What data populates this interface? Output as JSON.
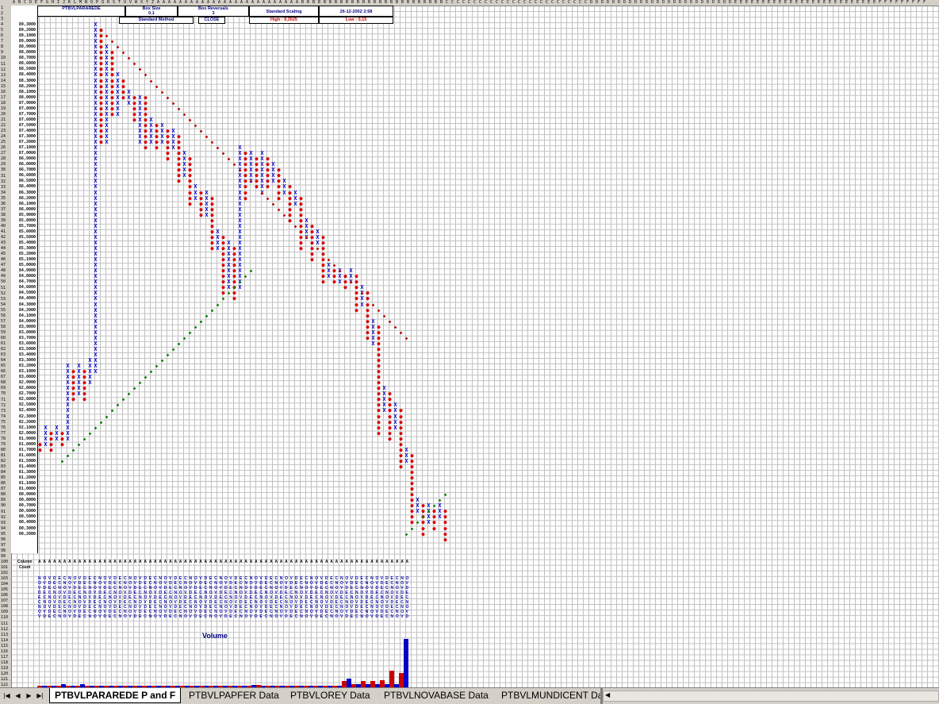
{
  "header": {
    "instrument": "PTBVLPARAREDE",
    "box_size_label": "Box Size",
    "box_size_value": "0,1",
    "box_reversal_label": "Box Reversals",
    "box_reversal_value": "3",
    "scaling": "Standard Scaling",
    "datetime": "26-12-2002 2:58",
    "method": "Standard Method",
    "price_basis": "CLOSE",
    "high": "High : 9,3025",
    "low": "Low : 0,15"
  },
  "price_levels": [
    "89,3000",
    "89,2000",
    "89,1000",
    "89,0000",
    "88,9000",
    "88,8000",
    "88,7000",
    "88,6000",
    "88,5000",
    "88,4000",
    "88,3000",
    "88,2000",
    "88,1000",
    "88,0000",
    "87,9000",
    "87,8000",
    "87,7000",
    "87,6000",
    "87,5000",
    "87,4000",
    "87,3000",
    "87,2000",
    "87,1000",
    "87,0000",
    "86,9000",
    "86,8000",
    "86,7000",
    "86,6000",
    "86,5000",
    "86,4000",
    "86,3000",
    "86,2000",
    "86,1000",
    "86,0000",
    "85,9000",
    "85,8000",
    "85,7000",
    "85,6000",
    "85,5000",
    "85,4000",
    "85,3000",
    "85,2000",
    "85,1000",
    "85,0000",
    "84,9000",
    "84,8000",
    "84,7000",
    "84,6000",
    "84,5000",
    "84,4000",
    "84,3000",
    "84,2000",
    "84,1000",
    "84,0000",
    "83,9000",
    "83,8000",
    "83,7000",
    "83,6000",
    "83,5000",
    "83,4000",
    "83,3000",
    "83,2000",
    "83,1000",
    "83,0000",
    "82,9000",
    "82,8000",
    "82,7000",
    "82,6000",
    "82,5000",
    "82,4000",
    "82,3000",
    "82,2000",
    "82,1000",
    "82,0000",
    "81,9000",
    "81,8000",
    "81,7000",
    "81,6000",
    "81,5000",
    "81,4000",
    "81,3000",
    "81,2000",
    "81,1000",
    "81,0000",
    "80,9000",
    "80,8000",
    "80,7000",
    "80,6000",
    "80,5000",
    "80,4000",
    "80,3000",
    "80,2000"
  ],
  "column_labels": {
    "column": "Column",
    "count": "Count"
  },
  "volume_title": "Volume",
  "tabs": [
    {
      "label": "PTBVLPARAREDE P and F",
      "active": true
    },
    {
      "label": "PTBVLPAPFER Data",
      "active": false
    },
    {
      "label": "PTBVLOREY Data",
      "active": false
    },
    {
      "label": "PTBVLNOVABASE Data",
      "active": false
    },
    {
      "label": "PTBVLMUNDICENT Da",
      "active": false
    }
  ],
  "nav_icons": [
    "first-sheet-icon",
    "prev-sheet-icon",
    "next-sheet-icon",
    "last-sheet-icon"
  ],
  "colors": {
    "x_mark": "#0000cc",
    "o_mark": "#dd0000",
    "trend_up": "#008000",
    "trend_down": "#c00000",
    "vol_blue": "#0000cc",
    "vol_red": "#cc0000"
  },
  "volume_values": [
    3,
    3,
    3,
    3,
    3,
    7,
    3,
    3,
    3,
    7,
    3,
    3,
    3,
    3,
    3,
    3,
    3,
    3,
    3,
    3,
    3,
    3,
    3,
    3,
    3,
    3,
    3,
    3,
    3,
    3,
    3,
    3,
    3,
    3,
    3,
    3,
    3,
    3,
    3,
    3,
    3,
    3,
    3,
    3,
    3,
    5,
    5,
    3,
    3,
    3,
    3,
    3,
    3,
    3,
    3,
    3,
    3,
    3,
    3,
    3,
    3,
    3,
    3,
    3,
    12,
    17,
    6,
    6,
    12,
    6,
    12,
    6,
    14,
    6,
    33,
    6,
    28,
    95
  ]
}
